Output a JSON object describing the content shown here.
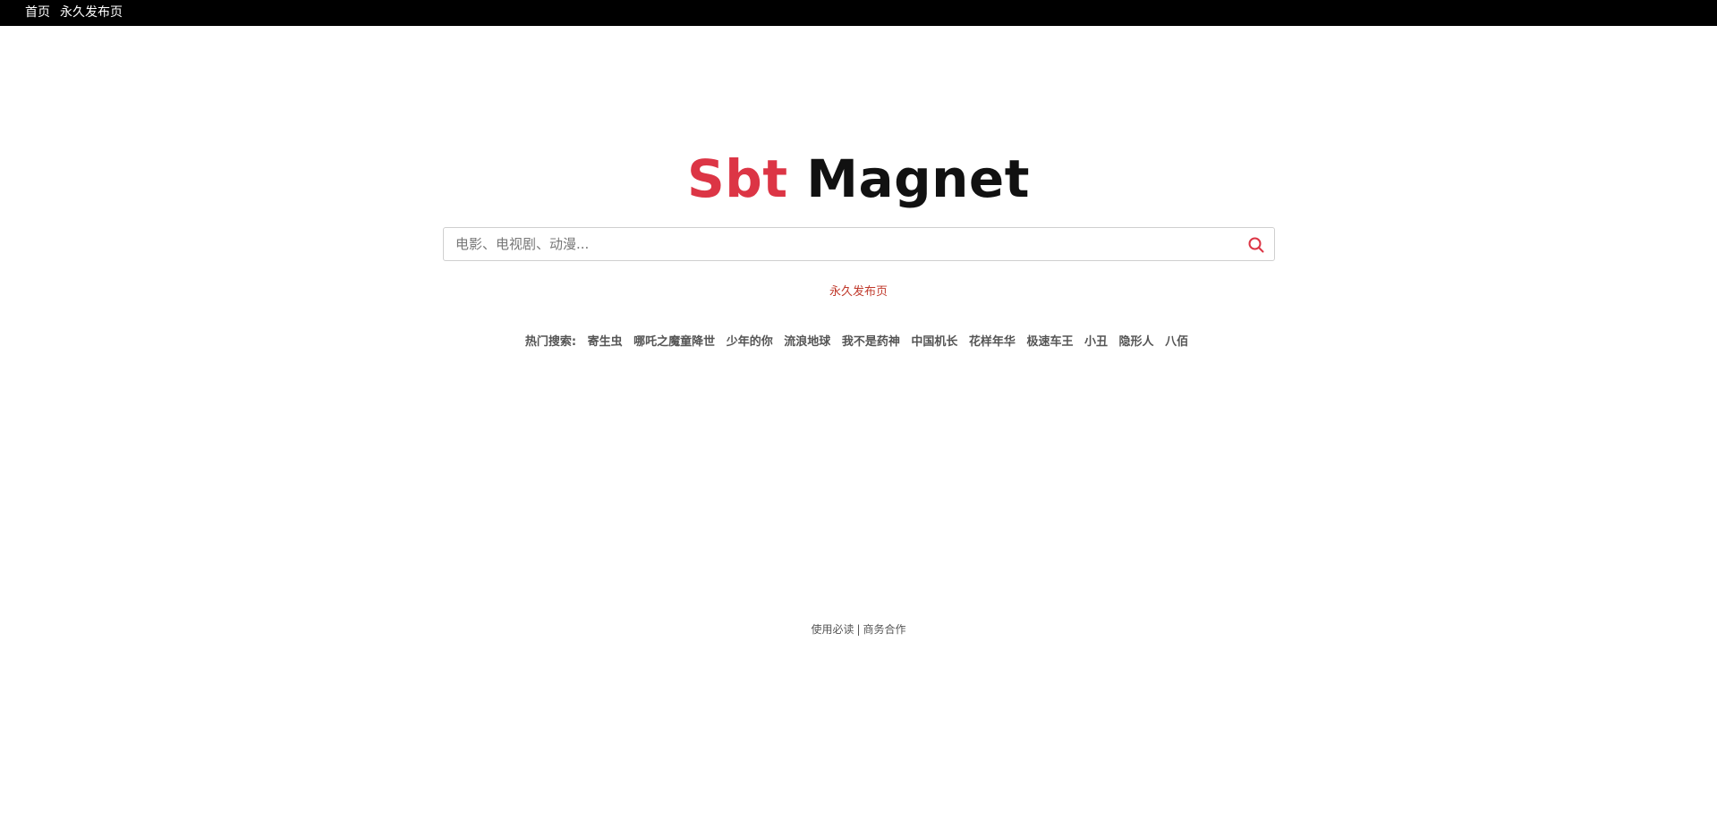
{
  "topnav": {
    "items": [
      {
        "label": "首页"
      },
      {
        "label": "永久发布页"
      }
    ]
  },
  "logo": {
    "part1": "Sbt",
    "part2": " Magnet",
    "part1_color": "#dc3545",
    "part2_color": "#111111"
  },
  "search": {
    "placeholder": "电影、电视剧、动漫...",
    "value": "",
    "button_icon": "search-icon",
    "icon_color": "#dc3545"
  },
  "permalink": {
    "label": "永久发布页"
  },
  "hot_search": {
    "label": "热门搜索:",
    "items": [
      "寄生虫",
      "哪吒之魔童降世",
      "少年的你",
      "流浪地球",
      "我不是药神",
      "中国机长",
      "花样年华",
      "极速车王",
      "小丑",
      "隐形人",
      "八佰"
    ]
  },
  "footer": {
    "link1": "使用必读",
    "separator": "|",
    "link2": "商务合作"
  }
}
